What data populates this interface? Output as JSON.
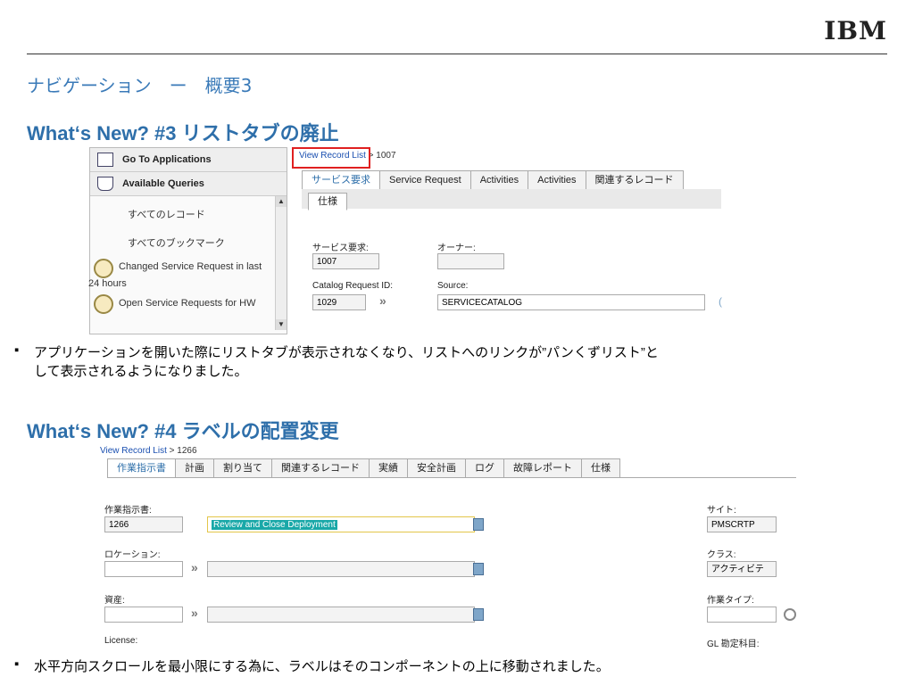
{
  "logo": "IBM",
  "slide_title": "ナビゲーション　ー　概要3",
  "section1": {
    "title": "What‘s New? #3 リストタブの廃止",
    "left_panel": {
      "go_to_apps": "Go To Applications",
      "available_queries": "Available Queries",
      "items": [
        "すべてのレコード",
        "すべてのブックマーク"
      ],
      "query1_line1": "Changed Service Request in last",
      "query1_line2": "24 hours",
      "query2": "Open Service Requests for HW"
    },
    "breadcrumb_link": "View Record List",
    "breadcrumb_rest": " > 1007",
    "tabs": [
      "サービス要求",
      "Service Request",
      "Activities",
      "Activities",
      "関連するレコード"
    ],
    "subtab": "仕様",
    "fields": {
      "sr_label": "サービス要求:",
      "sr_value": "1007",
      "owner_label": "オーナー:",
      "owner_value": "",
      "catalog_label": "Catalog Request ID:",
      "catalog_value": "1029",
      "source_label": "Source:",
      "source_value": "SERVICECATALOG"
    },
    "bullet": "アプリケーションを開いた際にリストタブが表示されなくなり、リストへのリンクが”パンくずリスト”と",
    "bullet_line2": "して表示されるようになりました。"
  },
  "section2": {
    "title": "What‘s New? #4 ラベルの配置変更",
    "breadcrumb_link": "View Record List",
    "breadcrumb_rest": " > 1266",
    "tabs": [
      "作業指示書",
      "計画",
      "割り当て",
      "関連するレコード",
      "実績",
      "安全計画",
      "ログ",
      "故障レポート",
      "仕様"
    ],
    "fields": {
      "wo_label": "作業指示書:",
      "wo_value": "1266",
      "desc_value": "Review and Close Deployment",
      "site_label": "サイト:",
      "site_value": "PMSCRTP",
      "location_label": "ロケーション:",
      "class_label": "クラス:",
      "class_value": "アクティビテ",
      "asset_label": "資産:",
      "worktype_label": "作業タイプ:",
      "license_label": "License:",
      "gl_label": "GL 勘定科目:"
    },
    "bullet": "水平方向スクロールを最小限にする為に、ラベルはそのコンポーネントの上に移動されました。"
  },
  "colors": {
    "title_blue": "#2e6faa",
    "highlight_red": "#e02020",
    "link_blue": "#1a4fb0"
  }
}
